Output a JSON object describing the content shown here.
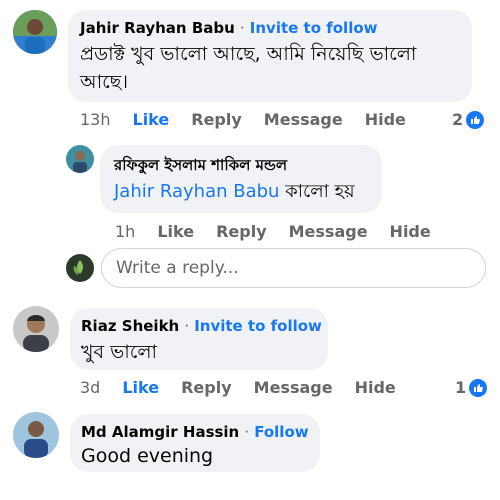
{
  "comments": [
    {
      "author": "Jahir Rayhan Babu",
      "separator": "·",
      "invite": "Invite to follow",
      "text_line1": "প্রডাক্ট খুব ভালো আছে, আমি নিয়েছি ভালো",
      "text_line2": "আছে।",
      "time": "13h",
      "like": "Like",
      "reply": "Reply",
      "message": "Message",
      "hide": "Hide",
      "reaction_count": "2"
    },
    {
      "author": "রফিকুল ইসলাম শাকিল মন্ডল",
      "mention": "Jahir Rayhan Babu",
      "text": " কালো হয়",
      "time": "1h",
      "like": "Like",
      "reply": "Reply",
      "message": "Message",
      "hide": "Hide"
    },
    {
      "author": "Riaz Sheikh",
      "separator": "·",
      "invite": "Invite to follow",
      "text": "খুব ভালো",
      "time": "3d",
      "like": "Like",
      "reply": "Reply",
      "message": "Message",
      "hide": "Hide",
      "reaction_count": "1"
    },
    {
      "author": "Md Alamgir Hassin",
      "separator": "·",
      "invite": "Follow",
      "text": "Good evening"
    }
  ],
  "reply_box": {
    "placeholder": "Write a reply..."
  },
  "colors": {
    "accent": "#1877f2",
    "bubble": "#f0f2f5",
    "muted": "#65676b"
  },
  "icons": [
    "like-badge-icon"
  ]
}
